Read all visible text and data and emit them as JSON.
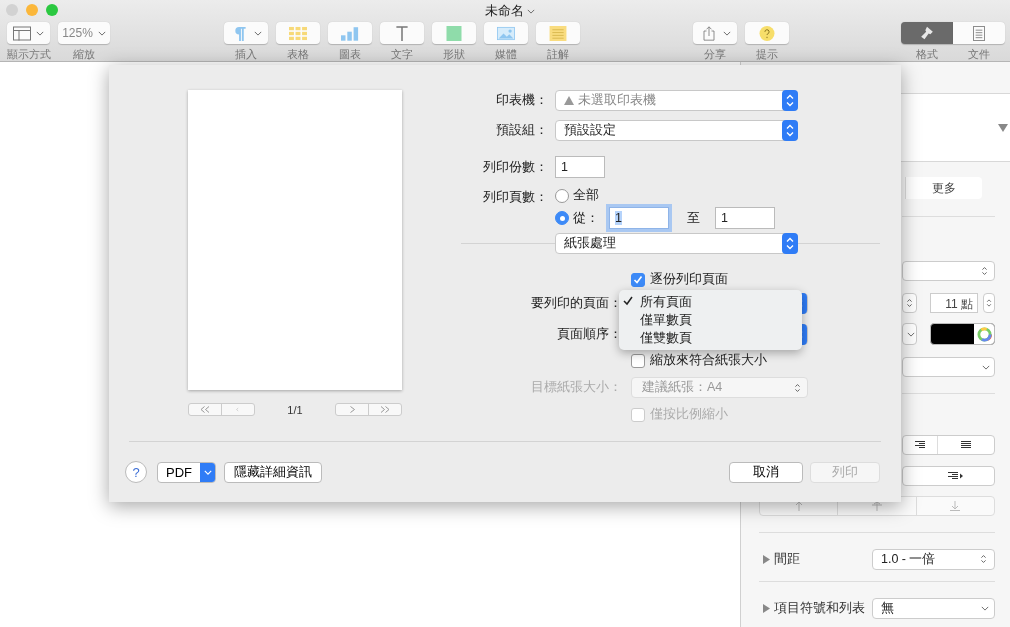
{
  "window": {
    "title": "未命名"
  },
  "toolbar": {
    "left": [
      {
        "kind": "view",
        "label": "顯示方式"
      },
      {
        "kind": "zoom",
        "label": "縮放",
        "value": "125%"
      }
    ],
    "insert": [
      {
        "kind": "insert",
        "label": "插入"
      },
      {
        "kind": "table",
        "label": "表格"
      },
      {
        "kind": "chart",
        "label": "圖表"
      },
      {
        "kind": "text",
        "label": "文字"
      },
      {
        "kind": "shape",
        "label": "形狀"
      },
      {
        "kind": "media",
        "label": "媒體"
      },
      {
        "kind": "comment",
        "label": "註解"
      }
    ],
    "right": [
      {
        "kind": "share",
        "label": "分享"
      },
      {
        "kind": "tips",
        "label": "提示"
      }
    ],
    "tabs": [
      {
        "kind": "format",
        "label": "格式",
        "selected": true
      },
      {
        "kind": "document",
        "label": "文件",
        "selected": false
      }
    ]
  },
  "sidebar": {
    "more_tab": "更多",
    "font_size": "11 點",
    "spacing": {
      "label": "間距",
      "value": "1.0 - 一倍"
    },
    "bullets": {
      "label": "項目符號和列表",
      "value": "無"
    }
  },
  "print_dialog": {
    "preview": {
      "page": "1/1"
    },
    "printer": {
      "label": "印表機：",
      "value": "未選取印表機"
    },
    "presets": {
      "label": "預設組：",
      "value": "預設設定"
    },
    "copies": {
      "label": "列印份數：",
      "value": "1"
    },
    "pages": {
      "label": "列印頁數：",
      "options": [
        {
          "label": "全部",
          "selected": false
        },
        {
          "label": "從：",
          "selected": true
        }
      ],
      "from": "1",
      "to_label": "至",
      "to": "1"
    },
    "section": "紙張處理",
    "collate": {
      "label": "逐份列印頁面",
      "checked": true
    },
    "pages_to_print": {
      "label": "要列印的頁面：",
      "menu": [
        {
          "label": "所有頁面",
          "selected": true
        },
        {
          "label": "僅單數頁",
          "selected": false
        },
        {
          "label": "僅雙數頁",
          "selected": false
        }
      ]
    },
    "page_order": {
      "label": "頁面順序："
    },
    "scale_to_fit": {
      "label": "縮放來符合紙張大小",
      "checked": false
    },
    "paper_size": {
      "label": "目標紙張大小：",
      "value": "建議紙張：A4",
      "disabled": true
    },
    "scale_down": {
      "label": "僅按比例縮小",
      "checked": false,
      "disabled": true
    },
    "help": "?",
    "pdf": "PDF",
    "details": "隱藏詳細資訊",
    "cancel": "取消",
    "print": {
      "label": "列印",
      "disabled": true
    }
  }
}
